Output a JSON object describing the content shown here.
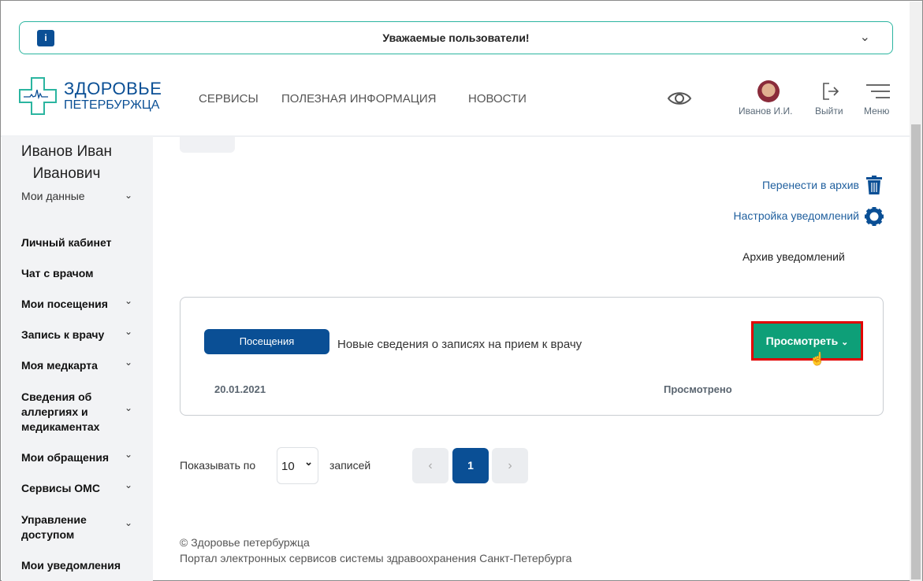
{
  "banner": {
    "info_icon": "i",
    "title": "Уважаемые пользователи!"
  },
  "logo": {
    "line1": "ЗДОРОВЬЕ",
    "line2": "ПЕТЕРБУРЖЦА"
  },
  "nav": [
    "СЕРВИСЫ",
    "ПОЛЕЗНАЯ ИНФОРМАЦИЯ",
    "НОВОСТИ"
  ],
  "header": {
    "user": "Иванов И.И.",
    "logout": "Выйти",
    "menu": "Меню"
  },
  "sidebar": {
    "name": "Иванов Иван Иванович",
    "my_data": "Мои данные",
    "items": [
      "Личный кабинет",
      "Чат с врачом",
      "Мои посещения",
      "Запись к врачу",
      "Моя медкарта",
      "Сведения об аллергиях и медикаментах",
      "Мои обращения",
      "Сервисы ОМС",
      "Управление доступом",
      "Мои уведомления"
    ]
  },
  "actions": {
    "archive": "Перенести в архив",
    "settings": "Настройка уведомлений",
    "archive_list": "Архив уведомлений"
  },
  "notification": {
    "category": "Посещения",
    "text": "Новые сведения о записях на прием к врачу",
    "date": "20.01.2021",
    "status": "Просмотрено",
    "view_button": "Просмотреть"
  },
  "pagination": {
    "show_label": "Показывать по",
    "per_page": "10",
    "records_label": "записей",
    "current_page": "1",
    "prev": "‹",
    "next": "›"
  },
  "footer": {
    "copyright": "© Здоровье петербуржца",
    "subtitle": "Портал электронных сервисов системы здравоохранения Санкт-Петербурга"
  },
  "colors": {
    "brand": "#0a4f95",
    "accent": "#0e9f78",
    "highlight": "#e20000"
  }
}
